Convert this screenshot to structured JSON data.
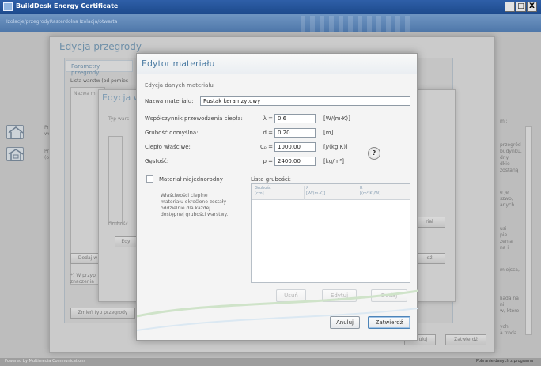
{
  "window": {
    "title": "BuildDesk Energy Certificate",
    "subtitle": "Izolacje/przegrodyRasterdolna Izolacja/otwarta",
    "buttons": [
      "_",
      "□",
      "X"
    ]
  },
  "footer": {
    "left": "Powered by Multimedia Communications",
    "right": "Pobranie danych z programu"
  },
  "rail": {
    "item1": [
      "Prz",
      "wst"
    ],
    "item2": [
      "Prz",
      "(obi"
    ]
  },
  "dialog_partition": {
    "title": "Edycja przegrody",
    "tab": "Parametry przegrody",
    "list_label": "Lista warstw (od pomies",
    "column_name": "Nazwa m",
    "add_layer_button": "Dodaj w",
    "note_lines": [
      "*) W przyp",
      "znaczenia"
    ],
    "change_type_button": "Zmień typ przegrody",
    "ok_button": "Anuluj",
    "confirm_button": "Zatwierdź",
    "right_text": [
      "mi:",
      "przegród",
      "budynku,",
      "dny",
      "dkie",
      "zostaną",
      "e je",
      "szwo,",
      "anych",
      "usi",
      "pie",
      "zenia",
      "na i",
      "miejsca,",
      "",
      "liada na",
      "ni,",
      "w, które",
      "ych",
      "a troda"
    ]
  },
  "dialog_layer": {
    "title": "Edycja w",
    "type_label": "Typ wars",
    "thickness_label": "Grubość",
    "edit_button": "Edy",
    "material_button": "riał",
    "radio_button": "dź"
  },
  "material_editor": {
    "title": "Edytor materiału",
    "section": "Edycja danych materiału",
    "name_label": "Nazwa materiału:",
    "name_value": "Pustak keramzytowy",
    "conductivity_label": "Współczynnik przewodzenia ciepła:",
    "conductivity_symbol": "λ =",
    "conductivity_value": "0,6",
    "conductivity_unit": "[W/(m·K)]",
    "thickness_label": "Grubość domyślna:",
    "thickness_symbol": "d =",
    "thickness_value": "0,20",
    "thickness_unit": "[m]",
    "heat_label": "Ciepło właściwe:",
    "heat_symbol": "Cₚ =",
    "heat_value": "1000.00",
    "heat_unit": "[J/(kg·K)]",
    "density_label": "Gęstość:",
    "density_symbol": "ρ =",
    "density_value": "2400.00",
    "density_unit": "[kg/m³]",
    "help": "?",
    "nonhomogeneous_label": "Materiał niejednorodny",
    "thickness_list_label": "Lista grubości:",
    "info_lines": [
      "Właściwości cieplne",
      "materiału określone zostały",
      "oddzielnie dla każdej",
      "dostępnej grubości warstwy."
    ],
    "table_headers": [
      {
        "l1": "Grubość",
        "l2": "[cm]"
      },
      {
        "l1": "λ",
        "l2": "[W/(m·K)]"
      },
      {
        "l1": "R",
        "l2": "[(m²·K)/W]"
      }
    ],
    "delete_button": "Usuń",
    "edit_button": "Edytuj",
    "add_button": "Dodaj",
    "cancel_button": "Anuluj",
    "confirm_button": "Zatwierdź"
  }
}
